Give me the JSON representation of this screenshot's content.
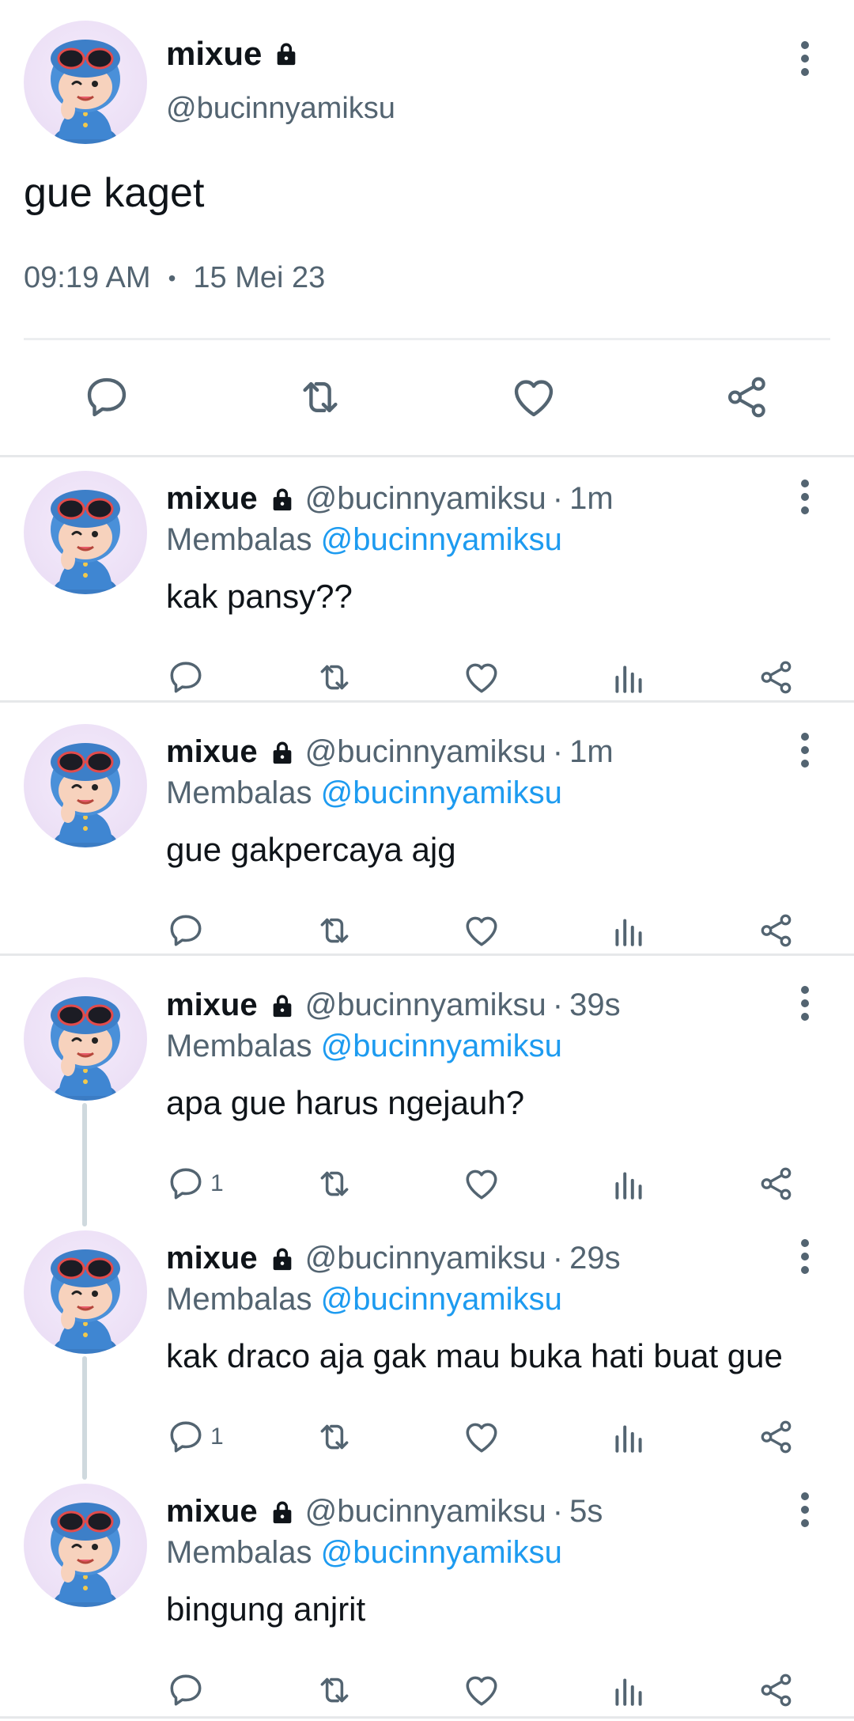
{
  "main_tweet": {
    "name": "mixue",
    "handle": "@bucinnyamiksu",
    "text": "gue kaget",
    "time": "09:19 AM",
    "dot": "•",
    "date": "15 Mei 23"
  },
  "replies": [
    {
      "name": "mixue",
      "handle": "@bucinnyamiksu",
      "sep": "·",
      "time": "1m",
      "replying_label": "Membalas",
      "mention": "@bucinnyamiksu",
      "text": "kak pansy??",
      "reply_count": ""
    },
    {
      "name": "mixue",
      "handle": "@bucinnyamiksu",
      "sep": "·",
      "time": "1m",
      "replying_label": "Membalas",
      "mention": "@bucinnyamiksu",
      "text": "gue gakpercaya ajg",
      "reply_count": ""
    },
    {
      "name": "mixue",
      "handle": "@bucinnyamiksu",
      "sep": "·",
      "time": "39s",
      "replying_label": "Membalas",
      "mention": "@bucinnyamiksu",
      "text": "apa gue harus ngejauh?",
      "reply_count": "1"
    },
    {
      "name": "mixue",
      "handle": "@bucinnyamiksu",
      "sep": "·",
      "time": "29s",
      "replying_label": "Membalas",
      "mention": "@bucinnyamiksu",
      "text": "kak draco aja gak mau buka hati buat gue",
      "reply_count": "1"
    },
    {
      "name": "mixue",
      "handle": "@bucinnyamiksu",
      "sep": "·",
      "time": "5s",
      "replying_label": "Membalas",
      "mention": "@bucinnyamiksu",
      "text": "bingung anjrit",
      "reply_count": ""
    }
  ],
  "icons": {
    "lock": "lock-icon",
    "more": "more-vertical-icon",
    "reply": "reply-icon",
    "retweet": "retweet-icon",
    "like": "heart-icon",
    "views": "views-icon",
    "share": "share-icon"
  },
  "colors": {
    "text": "#0f1419",
    "secondary": "#536471",
    "mention": "#1d9bf0",
    "divider": "#e6e8ea",
    "thread_line": "#cfd9de"
  }
}
